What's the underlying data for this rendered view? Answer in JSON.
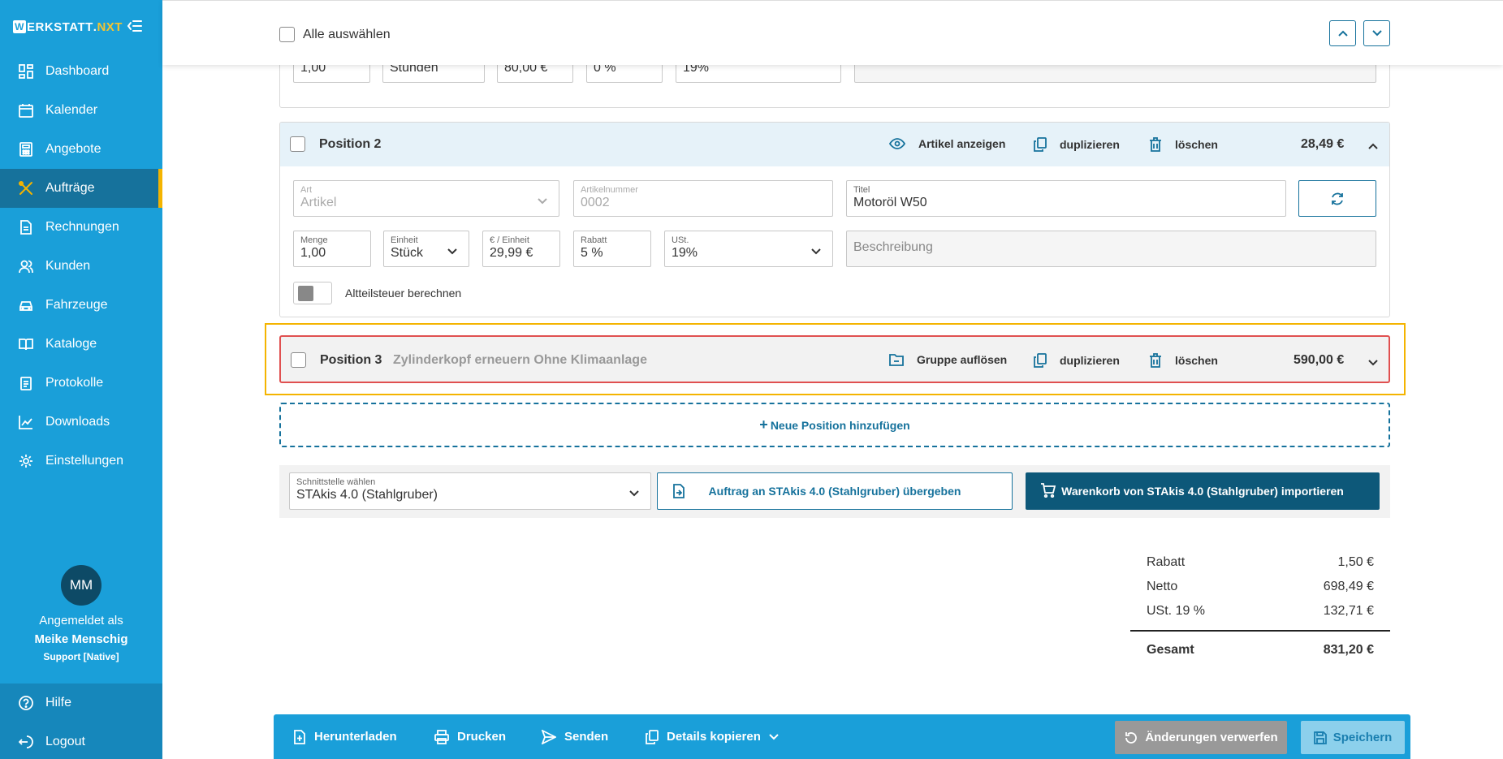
{
  "sidebar": {
    "logo_prefix": "ERKSTATT",
    "logo_mark": "W",
    "logo_dot": ".",
    "logo_suffix": "NXT",
    "items": [
      {
        "label": "Dashboard",
        "icon": "dashboard-icon"
      },
      {
        "label": "Kalender",
        "icon": "calendar-icon"
      },
      {
        "label": "Angebote",
        "icon": "calculator-icon"
      },
      {
        "label": "Aufträge",
        "icon": "tools-icon",
        "active": true
      },
      {
        "label": "Rechnungen",
        "icon": "document-icon"
      },
      {
        "label": "Kunden",
        "icon": "users-icon"
      },
      {
        "label": "Fahrzeuge",
        "icon": "car-icon"
      },
      {
        "label": "Kataloge",
        "icon": "book-icon"
      },
      {
        "label": "Protokolle",
        "icon": "clipboard-icon"
      },
      {
        "label": "Downloads",
        "icon": "chart-icon"
      },
      {
        "label": "Einstellungen",
        "icon": "gear-icon"
      }
    ],
    "user": {
      "initials": "MM",
      "logged_in_as": "Angemeldet als",
      "name": "Meike Menschig",
      "role": "Support [Native]"
    },
    "help_label": "Hilfe",
    "logout_label": "Logout"
  },
  "topbar": {
    "select_all_label": "Alle auswählen"
  },
  "position1": {
    "qty": "1,00",
    "unit": "Stunden",
    "price": "80,00 €",
    "discount": "0 %",
    "vat": "19%"
  },
  "position2": {
    "title": "Position 2",
    "show_article": "Artikel anzeigen",
    "duplicate": "duplizieren",
    "delete": "löschen",
    "price": "28,49 €",
    "fields": {
      "art_label": "Art",
      "art_value": "Artikel",
      "artnr_label": "Artikelnummer",
      "artnr_value": "0002",
      "titel_label": "Titel",
      "titel_value": "Motoröl W50",
      "menge_label": "Menge",
      "menge_value": "1,00",
      "einheit_label": "Einheit",
      "einheit_value": "Stück",
      "preis_label": "€ / Einheit",
      "preis_value": "29,99 €",
      "rabatt_label": "Rabatt",
      "rabatt_value": "5 %",
      "ust_label": "USt.",
      "ust_value": "19%",
      "beschreibung_placeholder": "Beschreibung"
    },
    "altteil_label": "Altteilsteuer berechnen"
  },
  "position3": {
    "title": "Position 3",
    "subtitle": "Zylinderkopf erneuern Ohne Klimaanlage",
    "ungroup": "Gruppe auflösen",
    "duplicate": "duplizieren",
    "delete": "löschen",
    "price": "590,00 €"
  },
  "add_position_label": "Neue Position hinzufügen",
  "interface": {
    "select_label": "Schnittstelle wählen",
    "select_value": "STAkis 4.0 (Stahlgruber)",
    "transfer_label": "Auftrag an STAkis 4.0 (Stahlgruber) übergeben",
    "import_label": "Warenkorb von STAkis 4.0 (Stahlgruber) importieren"
  },
  "totals": {
    "rows": [
      {
        "label": "Rabatt",
        "value": "1,50 €"
      },
      {
        "label": "Netto",
        "value": "698,49 €"
      },
      {
        "label": "USt. 19 %",
        "value": "132,71 €"
      }
    ],
    "total_label": "Gesamt",
    "total_value": "831,20 €"
  },
  "bottom_bar": {
    "download": "Herunterladen",
    "print": "Drucken",
    "send": "Senden",
    "copy_details": "Details kopieren",
    "discard": "Änderungen verwerfen",
    "save": "Speichern"
  },
  "colors": {
    "primary": "#1a9fd9",
    "dark": "#0d5879",
    "accent": "#f4b400",
    "error": "#e05050"
  }
}
